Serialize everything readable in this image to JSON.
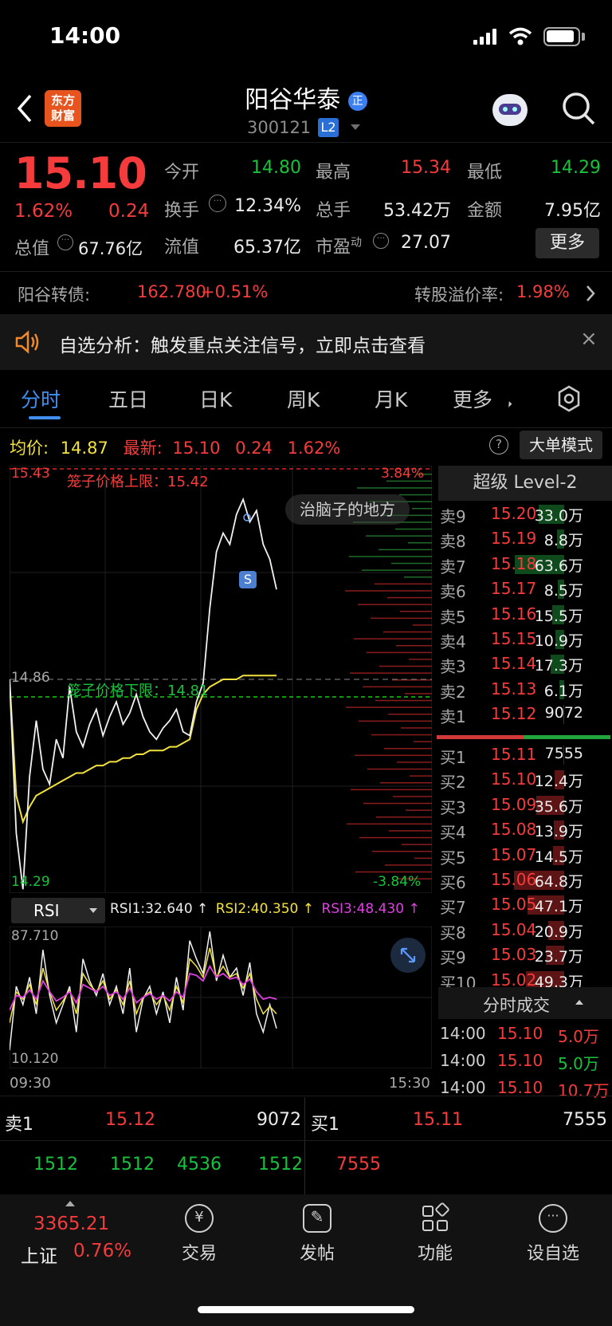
{
  "status": {
    "time": "14:00"
  },
  "header": {
    "name": "阳谷华泰",
    "code": "300121",
    "badge": "L2",
    "logo_line1": "东方",
    "logo_line2": "财富",
    "tag": "正"
  },
  "quote": {
    "price": "15.10",
    "pct": "1.62%",
    "chg": "0.24",
    "open_label": "今开",
    "open": "14.80",
    "high_label": "最高",
    "high": "15.34",
    "low_label": "最低",
    "low": "14.29",
    "turnover_label": "换手",
    "turnover": "12.34%",
    "volume_label": "总手",
    "volume": "53.42万",
    "amount_label": "金额",
    "amount": "7.95亿",
    "mktcap_label": "总值",
    "mktcap": "67.76亿",
    "float_label": "流值",
    "float": "65.37亿",
    "pe_label": "市盈",
    "pe_sup": "动",
    "pe": "27.07",
    "more": "更多"
  },
  "bond": {
    "label": "阳谷转债:",
    "price": "162.780",
    "pct": "+0.51%",
    "premium_label": "转股溢价率:",
    "premium": "1.98%"
  },
  "notice": {
    "text": "自选分析：触发重点关注信号，立即点击查看"
  },
  "tabs": [
    "分时",
    "五日",
    "日K",
    "周K",
    "月K",
    "更多"
  ],
  "chart_header": {
    "avg_label": "均价:",
    "avg": "14.87",
    "latest_label": "最新:",
    "latest": "15.10",
    "chg": "0.24",
    "pct": "1.62%",
    "mode_button": "大单模式"
  },
  "chart_data": {
    "type": "line",
    "title": "",
    "y_top": "15.43",
    "y_mid": "14.86",
    "y_bottom": "14.29",
    "pct_top": "3.84%",
    "pct_bottom": "-3.84%",
    "upper_limit_label": "笼子价格上限：15.42",
    "lower_limit_label": "笼子价格下限：14.81",
    "overlay_label": "治脑子的地方",
    "signal_marker": "S",
    "ylim": [
      14.29,
      15.43
    ],
    "x_labels": [
      "09:30",
      "15:30"
    ],
    "price_series": [
      14.86,
      14.45,
      14.3,
      14.6,
      14.75,
      14.62,
      14.58,
      14.7,
      14.65,
      14.84,
      14.72,
      14.68,
      14.74,
      14.78,
      14.71,
      14.76,
      14.8,
      14.74,
      14.77,
      14.82,
      14.76,
      14.72,
      14.7,
      14.73,
      14.75,
      14.78,
      14.72,
      14.71,
      14.8,
      14.85,
      15.05,
      15.2,
      15.25,
      15.22,
      15.3,
      15.34,
      15.28,
      15.31,
      15.22,
      15.18,
      15.1
    ],
    "avg_series": [
      14.86,
      14.55,
      14.48,
      14.52,
      14.55,
      14.56,
      14.57,
      14.58,
      14.59,
      14.6,
      14.61,
      14.61,
      14.62,
      14.63,
      14.63,
      14.64,
      14.64,
      14.65,
      14.65,
      14.66,
      14.66,
      14.67,
      14.67,
      14.67,
      14.68,
      14.68,
      14.69,
      14.7,
      14.78,
      14.82,
      14.84,
      14.85,
      14.86,
      14.86,
      14.86,
      14.87,
      14.87,
      14.87,
      14.87,
      14.87,
      14.87
    ]
  },
  "rsi": {
    "label": "RSI",
    "rsi1": "RSI1:32.640 ↑",
    "rsi2": "RSI2:40.350 ↑",
    "rsi3": "RSI3:48.430 ↑",
    "y_top": "87.710",
    "y_bottom": "10.120",
    "x_start": "09:30",
    "x_end": "15:30",
    "rsi1_series": [
      20,
      55,
      45,
      60,
      40,
      75,
      50,
      35,
      45,
      55,
      30,
      70,
      58,
      50,
      62,
      45,
      55,
      40,
      65,
      30,
      48,
      55,
      40,
      52,
      35,
      60,
      42,
      80,
      70,
      62,
      85,
      58,
      72,
      60,
      65,
      50,
      68,
      40,
      30,
      45,
      32
    ],
    "rsi2_series": [
      35,
      52,
      48,
      56,
      45,
      65,
      52,
      42,
      47,
      53,
      40,
      62,
      56,
      52,
      58,
      48,
      53,
      45,
      58,
      40,
      49,
      52,
      45,
      50,
      42,
      55,
      46,
      70,
      66,
      60,
      76,
      60,
      66,
      60,
      62,
      54,
      62,
      48,
      40,
      44,
      40
    ],
    "rsi3_series": [
      42,
      50,
      49,
      53,
      48,
      58,
      52,
      47,
      49,
      52,
      46,
      56,
      54,
      52,
      55,
      50,
      52,
      48,
      54,
      46,
      49,
      51,
      48,
      50,
      47,
      52,
      49,
      62,
      61,
      58,
      66,
      60,
      62,
      59,
      60,
      56,
      59,
      52,
      48,
      49,
      48
    ]
  },
  "orderbook": {
    "title": "超级 Level-2",
    "asks": [
      {
        "label": "卖9",
        "price": "15.20",
        "vol": "33.0万"
      },
      {
        "label": "卖8",
        "price": "15.19",
        "vol": "8.8万"
      },
      {
        "label": "卖7",
        "price": "15.18",
        "vol": "63.6万"
      },
      {
        "label": "卖6",
        "price": "15.17",
        "vol": "8.5万"
      },
      {
        "label": "卖5",
        "price": "15.16",
        "vol": "15.5万"
      },
      {
        "label": "卖4",
        "price": "15.15",
        "vol": "10.9万"
      },
      {
        "label": "卖3",
        "price": "15.14",
        "vol": "17.3万"
      },
      {
        "label": "卖2",
        "price": "15.13",
        "vol": "6.1万"
      },
      {
        "label": "卖1",
        "price": "15.12",
        "vol": "9072"
      }
    ],
    "bids": [
      {
        "label": "买1",
        "price": "15.11",
        "vol": "7555"
      },
      {
        "label": "买2",
        "price": "15.10",
        "vol": "12.4万"
      },
      {
        "label": "买3",
        "price": "15.09",
        "vol": "35.6万"
      },
      {
        "label": "买4",
        "price": "15.08",
        "vol": "13.9万"
      },
      {
        "label": "买5",
        "price": "15.07",
        "vol": "14.5万"
      },
      {
        "label": "买6",
        "price": "15.06",
        "vol": "64.8万"
      },
      {
        "label": "买7",
        "price": "15.05",
        "vol": "47.1万"
      },
      {
        "label": "买8",
        "price": "15.04",
        "vol": "20.9万"
      },
      {
        "label": "买9",
        "price": "15.03",
        "vol": "23.7万"
      },
      {
        "label": "买10",
        "price": "15.02",
        "vol": "49.3万"
      }
    ],
    "ticks_title": "分时成交",
    "ticks": [
      {
        "time": "14:00",
        "price": "15.10",
        "vol": "5.0万",
        "color": "red"
      },
      {
        "time": "14:00",
        "price": "15.10",
        "vol": "5.0万",
        "color": "green"
      },
      {
        "time": "14:00",
        "price": "15.10",
        "vol": "10.7万",
        "color": "red"
      }
    ]
  },
  "queue": {
    "sell_label": "卖1",
    "sell_price": "15.12",
    "sell_vol": "9072",
    "buy_label": "买1",
    "buy_price": "15.11",
    "buy_vol": "7555",
    "sell_orders": [
      "1512",
      "1512",
      "4536",
      "1512"
    ],
    "buy_orders": [
      "7555"
    ]
  },
  "nav": {
    "index_value": "3365.21",
    "index_name": "上证",
    "index_pct": "0.76%",
    "items": [
      "交易",
      "发帖",
      "功能",
      "设自选"
    ]
  }
}
